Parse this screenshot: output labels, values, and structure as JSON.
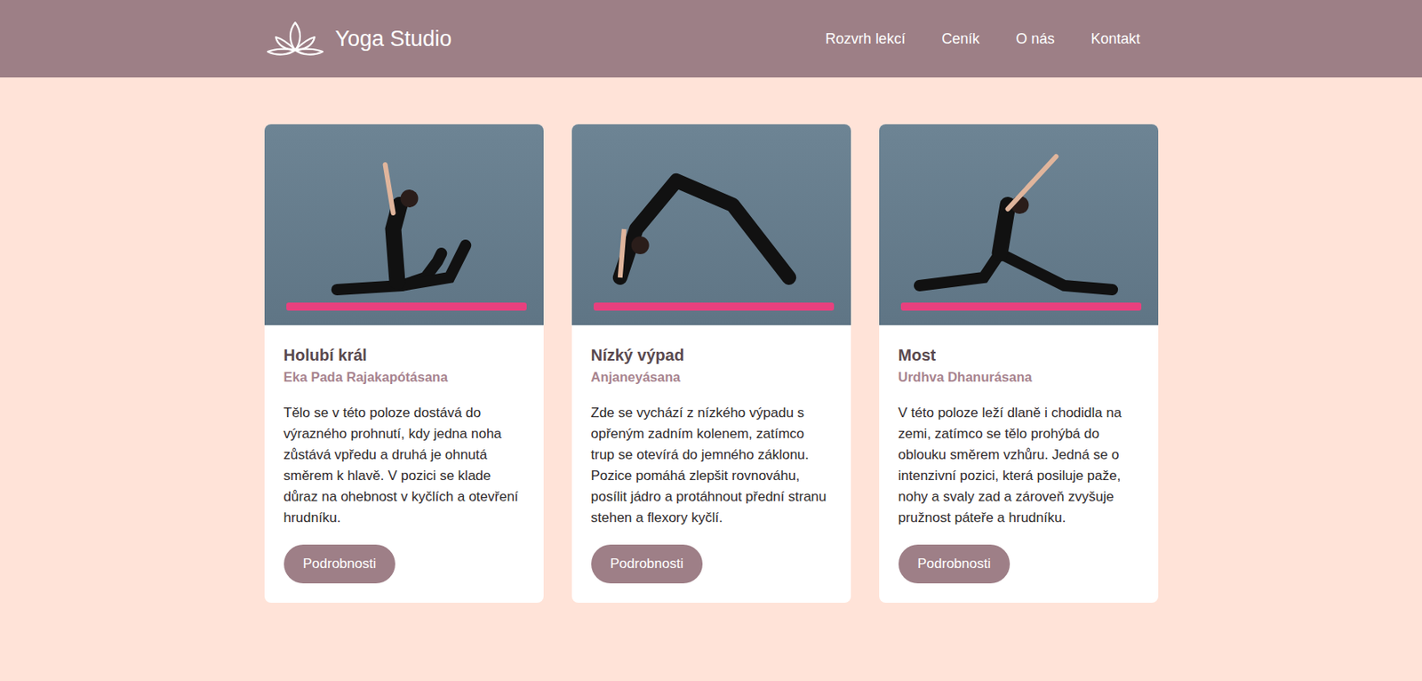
{
  "header": {
    "logo": "Yoga Studio",
    "nav": [
      "Rozvrh lekcí",
      "Ceník",
      "O nás",
      "Kontakt"
    ]
  },
  "cards": [
    {
      "title": "Holubí král",
      "subtitle": "Eka Pada Rajakapótásana",
      "text": "Tělo se v této poloze dostává do výrazného prohnutí, kdy jedna noha zůstává vpředu a druhá je ohnutá směrem k hlavě. V pozici se klade důraz na ohebnost v kyčlích a otevření hrudníku.",
      "button": "Podrobnosti"
    },
    {
      "title": "Nízký výpad",
      "subtitle": "Anjaneyásana",
      "text": "Zde se vychází z nízkého výpadu s opřeným zadním kolenem, zatímco trup se otevírá do jemného záklonu. Pozice pomáhá zlepšit rovnováhu, posílit jádro a protáhnout přední stranu stehen a flexory kyčlí.",
      "button": "Podrobnosti"
    },
    {
      "title": "Most",
      "subtitle": "Urdhva Dhanurásana",
      "text": "V této poloze leží dlaně i chodidla na zemi, zatímco se tělo prohýbá do oblouku směrem vzhůru. Jedná se o intenzivní pozici, která posiluje paže, nohy a svaly zad a zároveň zvyšuje pružnost páteře a hrudníku.",
      "button": "Podrobnosti"
    }
  ]
}
